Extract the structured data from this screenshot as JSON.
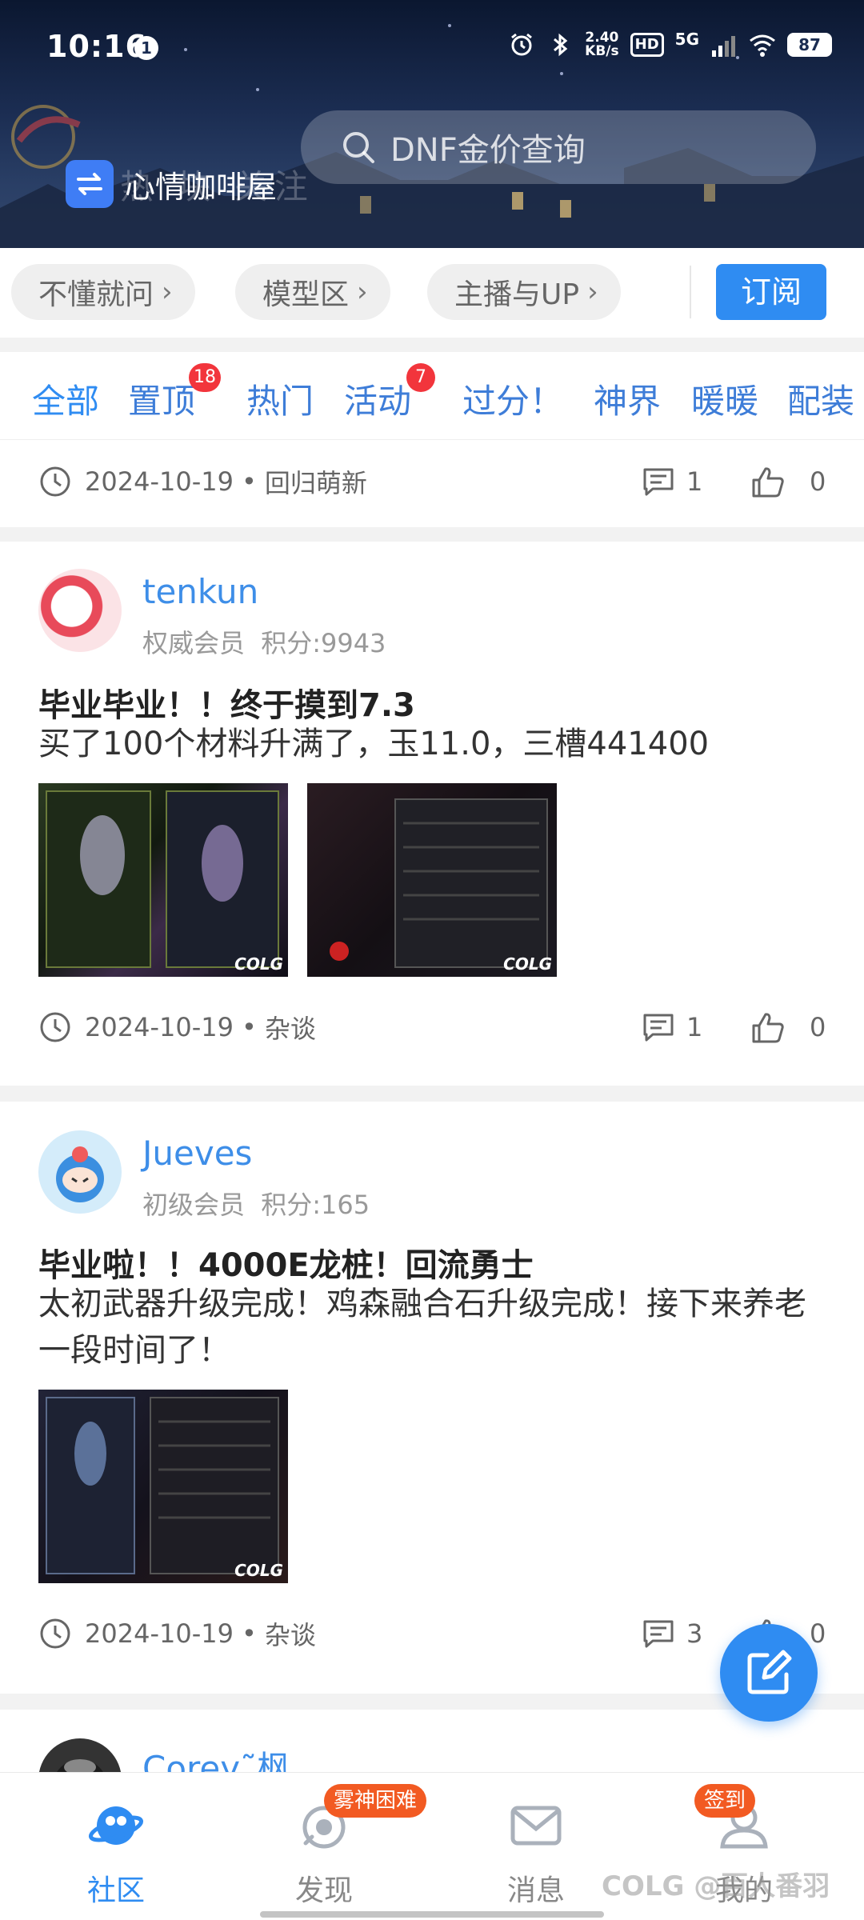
{
  "status_bar": {
    "time": "10:16",
    "notification_count": "1",
    "network_speed_value": "2.40",
    "network_speed_unit": "KB/s",
    "hd_label": "HD",
    "network_type": "5G",
    "battery": "87"
  },
  "header": {
    "community_name": "心情咖啡屋",
    "ghost_tabs": "热 块 关注",
    "search_placeholder": "DNF金价查询"
  },
  "topic_chips": [
    {
      "label": "不懂就问"
    },
    {
      "label": "模型区"
    },
    {
      "label": "主播与UP"
    }
  ],
  "subscribe_label": "订阅",
  "filter_tabs": [
    {
      "label": "全部",
      "active": true
    },
    {
      "label": "置顶",
      "badge": "18"
    },
    {
      "label": "热门"
    },
    {
      "label": "活动",
      "badge": "7"
    },
    {
      "label": "过分！"
    },
    {
      "label": "神界"
    },
    {
      "label": "暖暖"
    },
    {
      "label": "配装"
    }
  ],
  "posts": [
    {
      "date": "2024-10-19",
      "category": "回归萌新",
      "comments": "1",
      "likes": "0"
    },
    {
      "username": "tenkun",
      "member_level": "权威会员",
      "points": "积分:9943",
      "title": "毕业毕业！！终于摸到7.3",
      "body": "买了100个材料升满了，玉11.0，三槽441400",
      "image_tag": "COLG",
      "date": "2024-10-19",
      "category": "杂谈",
      "comments": "1",
      "likes": "0"
    },
    {
      "username": "Jueves",
      "member_level": "初级会员",
      "points": "积分:165",
      "title": "毕业啦！！4000E龙桩！回流勇士",
      "body": "太初武器升级完成！鸡森融合石升级完成！接下来养老一段时间了！",
      "image_tag": "COLG",
      "date": "2024-10-19",
      "category": "杂谈",
      "comments": "3",
      "likes": "0"
    },
    {
      "username": "Corey˜枫"
    }
  ],
  "bottom_nav": [
    {
      "label": "社区",
      "active": true
    },
    {
      "label": "发现",
      "badge": "雾神困难"
    },
    {
      "label": "消息"
    },
    {
      "label": "我的",
      "badge": "签到"
    }
  ],
  "watermark": "COLG @百人番羽",
  "colors": {
    "accent": "#2f8cf2",
    "badge_red": "#f2353c",
    "badge_orange": "#f25a22",
    "username_blue": "#3e8ee8"
  }
}
